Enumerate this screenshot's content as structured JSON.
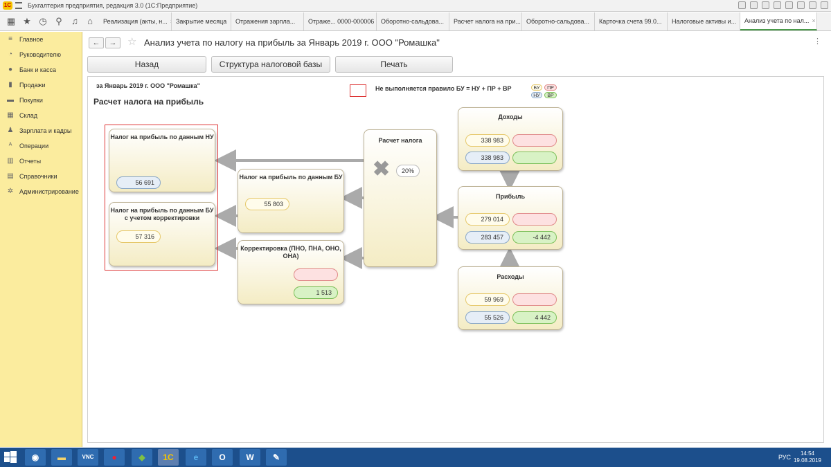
{
  "window": {
    "title": "Бухгалтерия предприятия, редакция 3.0  (1С:Предприятие)"
  },
  "tabs": [
    {
      "label": "Реализация (акты, н..."
    },
    {
      "label": "Закрытие месяца"
    },
    {
      "label": "Отражения зарпла..."
    },
    {
      "label": "Отраже... 0000-000006"
    },
    {
      "label": "Оборотно-сальдова..."
    },
    {
      "label": "Расчет налога на при..."
    },
    {
      "label": "Оборотно-сальдова..."
    },
    {
      "label": "Карточка счета 99.0..."
    },
    {
      "label": "Налоговые активы и..."
    },
    {
      "label": "Анализ учета по нал..."
    }
  ],
  "sidebar": {
    "items": [
      {
        "label": "Главное",
        "icon": "menu-icon"
      },
      {
        "label": "Руководителю",
        "icon": "chart-icon"
      },
      {
        "label": "Банк и касса",
        "icon": "bank-icon"
      },
      {
        "label": "Продажи",
        "icon": "bag-icon"
      },
      {
        "label": "Покупки",
        "icon": "cart-icon"
      },
      {
        "label": "Склад",
        "icon": "warehouse-icon"
      },
      {
        "label": "Зарплата и кадры",
        "icon": "person-icon"
      },
      {
        "label": "Операции",
        "icon": "operations-icon"
      },
      {
        "label": "Отчеты",
        "icon": "report-icon"
      },
      {
        "label": "Справочники",
        "icon": "book-icon"
      },
      {
        "label": "Администрирование",
        "icon": "gear-icon"
      }
    ]
  },
  "page": {
    "title": "Анализ учета по налогу на прибыль за Январь 2019 г. ООО \"Ромашка\""
  },
  "buttons": {
    "back": "Назад",
    "structure": "Структура налоговой базы",
    "print": "Печать"
  },
  "report": {
    "period": "за Январь 2019 г. ООО \"Ромашка\"",
    "title": "Расчет налога на прибыль",
    "legend_text": "Не выполняется правило БУ = НУ + ПР + ВР",
    "legend_pills": [
      "БУ",
      "ПР",
      "НУ",
      "ВР"
    ],
    "cards": {
      "tax_nu": {
        "title": "Налог на прибыль по данным НУ",
        "value": "56 691"
      },
      "tax_bu_adj": {
        "title": "Налог на прибыль по данным БУ с учетом корректировки",
        "value": "57 316"
      },
      "tax_bu": {
        "title": "Налог на прибыль по данным БУ",
        "value": "55 803"
      },
      "correction": {
        "title": "Корректировка (ПНО, ПНА, ОНО, ОНА)",
        "value_vr": "1 513"
      },
      "calc": {
        "title": "Расчет налога",
        "rate": "20%"
      },
      "income": {
        "title": "Доходы",
        "bu": "338 983",
        "nu": "338 983"
      },
      "profit": {
        "title": "Прибыль",
        "bu": "279 014",
        "nu": "283 457",
        "vr": "-4 442"
      },
      "expenses": {
        "title": "Расходы",
        "bu": "59 969",
        "nu": "55 526",
        "vr": "4 442"
      }
    }
  },
  "taskbar": {
    "lang": "РУС",
    "time": "14:54",
    "date": "19.08.2019"
  },
  "colors": {
    "sidebar": "#fbec9e",
    "taskbar": "#1c4f8c",
    "error_frame": "#dd3333"
  }
}
